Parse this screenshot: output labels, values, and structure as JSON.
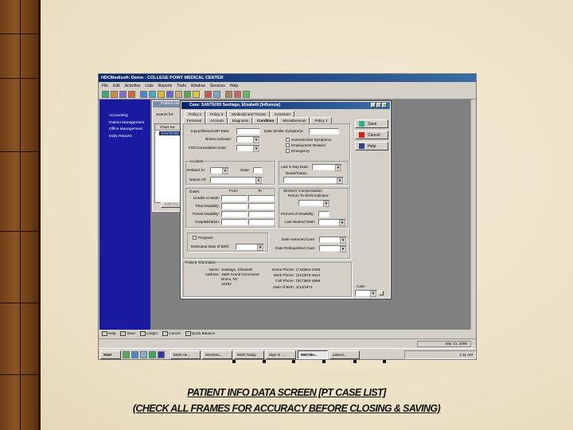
{
  "app": {
    "title": "HDCMedisoft: Demo - COLLEGE POINT MEDICAL CENTER",
    "menu": [
      "File",
      "Edit",
      "Activities",
      "Lists",
      "Reports",
      "Tools",
      "Window",
      "Services",
      "Help"
    ],
    "sidebar": [
      "Accounting",
      "Patient Management",
      "Office Management",
      "Daily Reports"
    ]
  },
  "patient_list": {
    "title": "Patient List",
    "search_label": "Search for:",
    "column": "Chart No.",
    "rows": [
      "SANTE000"
    ],
    "edit_button": "Edit Pa"
  },
  "dialog": {
    "title": "Case: SANTE000 Santiago, Elizabeth [Influenza]",
    "tabs_row1": [
      "Policy 2",
      "Policy 3",
      "Medicaid and Tricare",
      "Comment"
    ],
    "tabs_row2": [
      "Personal",
      "Account",
      "Diagnosis",
      "Condition",
      "Miscellaneous",
      "Policy 1"
    ],
    "active_tab": "Condition",
    "buttons": {
      "save": "Save",
      "cancel": "Cancel",
      "help": "Help"
    },
    "condition": {
      "injury_date": "Injury/Illness/LMP Date:",
      "illness_indicator": "Illness Indicator:",
      "first_consult": "First Consultation Date:",
      "similar_symptoms": "Date Similar Symptoms:",
      "same_similar": "Same/Similar Symptoms",
      "employment_related": "Employment Related",
      "emergency": "Emergency"
    },
    "accident": {
      "group": "Accident",
      "related_to": "Related To:",
      "state": "State:",
      "nature_of": "Nature Of:"
    },
    "xray": {
      "last_xray": "Last X-Ray Date:",
      "death_status": "Death/Status"
    },
    "dates": {
      "group": "Dates:",
      "from": "From",
      "to": "To",
      "rows": [
        "Unable to Work:",
        "Total Disability:",
        "Partial Disability:",
        "Hospitalization:"
      ]
    },
    "workers": {
      "group": "Workers' Compensation",
      "return_to_work": "Return To Work Indicator:",
      "percent_disability": "Percent of Disability:",
      "last_worked": "Last Worked Date:"
    },
    "pregnancy": {
      "pregnant": "Pregnant",
      "estimated_dob": "Estimated Date of Birth:",
      "date_assumed": "Date Assumed Care:",
      "date_relinquished": "Date Relinquished Care:"
    },
    "patient_info": {
      "group": "Patient Information",
      "name_label": "Name:",
      "name": "Santiago, Elizabeth",
      "address_label": "Address:",
      "address": [
        "1560 Grand Concourse",
        "Bronx, NY",
        "10452"
      ],
      "home_phone_label": "Home Phone:",
      "home_phone": "(718)561-2345",
      "work_phone_label": "Work Phone:",
      "work_phone": "(212)876-4514",
      "cell_phone_label": "Cell Phone:",
      "cell_phone": "(917)563-4596",
      "dob_label": "Date of Birth:",
      "dob": "3/14/1973"
    },
    "case_label": "Case"
  },
  "fkeys": [
    "Help",
    "Save",
    "Ledger",
    "Cancel",
    "Quick Balance"
  ],
  "status": {
    "date": "Mar 13, 2006"
  },
  "taskbar": {
    "start": "Start",
    "tasks": [
      "MSN He...",
      "Wireless...",
      "MSN Today",
      "Sign In -...",
      "MDCMe...",
      "patient..."
    ],
    "active": 4,
    "clock": "1:11 AM"
  },
  "caption": {
    "line1": "PATIENT INFO DATA SCREEN  [PT CASE LIST]",
    "line2": "(CHECK ALL FRAMES FOR ACCURACY BEFORE CLOSING & SAVING)"
  }
}
